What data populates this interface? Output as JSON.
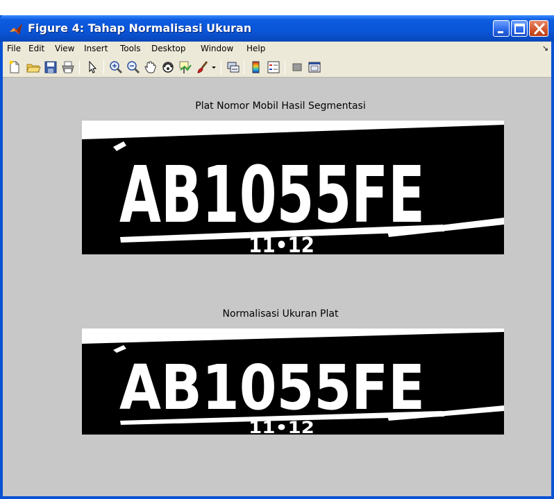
{
  "window": {
    "title": "Figure 4: Tahap Normalisasi Ukuran"
  },
  "menu": {
    "items": [
      "File",
      "Edit",
      "View",
      "Insert",
      "Tools",
      "Desktop",
      "Window",
      "Help"
    ],
    "overflow_glyph": "↘"
  },
  "toolbar": {
    "buttons": [
      "new-figure",
      "open-file",
      "save",
      "print",
      "edit-plot",
      "zoom-in",
      "zoom-out",
      "pan",
      "rotate-3d",
      "data-cursor",
      "brush",
      "link-plot",
      "colorbar",
      "legend",
      "hide-plot-tools",
      "show-plot-tools"
    ]
  },
  "axes": [
    {
      "title": "Plat Nomor Mobil Hasil Segmentasi",
      "plate_main": "AB1055FE",
      "plate_sub": "11•12"
    },
    {
      "title": "Normalisasi Ukuran Plat",
      "plate_main": "AB1055FE",
      "plate_sub": "11•12"
    }
  ],
  "colors": {
    "titlebar": "#0a55d8",
    "figure_bg": "#c8c8c8",
    "menubar_bg": "#ece9d8",
    "plate_bg": "#000000",
    "plate_fg": "#ffffff"
  }
}
